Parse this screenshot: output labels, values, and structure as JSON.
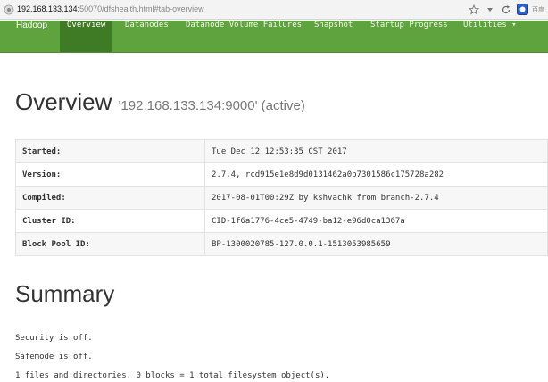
{
  "browser": {
    "url_host": "192.168.133.134:",
    "url_rest": "50070/dfshealth.html#tab-overview",
    "search_engine": "百度"
  },
  "navbar": {
    "brand": "Hadoop",
    "items": [
      {
        "label": "Overview",
        "active": true
      },
      {
        "label": "Datanodes"
      },
      {
        "label": "Datanode Volume Failures"
      },
      {
        "label": "Snapshot"
      },
      {
        "label": "Startup Progress"
      },
      {
        "label": "Utilities ▾"
      }
    ]
  },
  "overview": {
    "title": "Overview",
    "subtitle": "'192.168.133.134:9000' (active)",
    "rows": [
      {
        "key": "Started:",
        "value": "Tue Dec 12 12:53:35 CST 2017"
      },
      {
        "key": "Version:",
        "value": "2.7.4, rcd915e1e8d9d0131462a0b7301586c175728a282"
      },
      {
        "key": "Compiled:",
        "value": "2017-08-01T00:29Z by kshvachk from branch-2.7.4"
      },
      {
        "key": "Cluster ID:",
        "value": "CID-1f6a1776-4ce5-4749-ba12-e96d0ca1367a"
      },
      {
        "key": "Block Pool ID:",
        "value": "BP-1300020785-127.0.0.1-1513053985659"
      }
    ]
  },
  "summary": {
    "title": "Summary",
    "lines": [
      "Security is off.",
      "Safemode is off.",
      "1 files and directories, 0 blocks = 1 total filesystem object(s)."
    ]
  }
}
